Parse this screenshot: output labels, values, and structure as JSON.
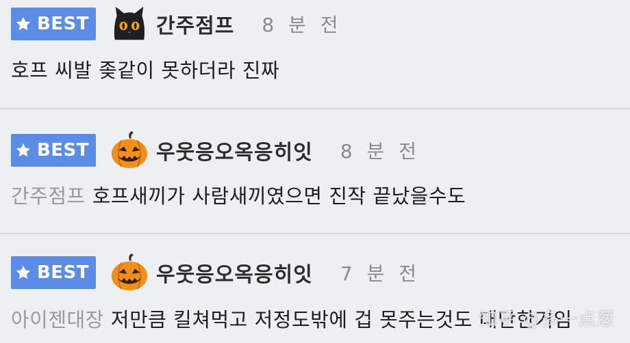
{
  "comments": [
    {
      "badge": "BEST",
      "username": "간주점프",
      "avatar_icon": "black-cat-icon",
      "time": "8 분 전",
      "reply_to": "",
      "text": "호프 씨발 좆같이 못하더라 진짜"
    },
    {
      "badge": "BEST",
      "username": "우웃응오옥응히잇",
      "avatar_icon": "jack-o-lantern-icon",
      "time": "8 분 전",
      "reply_to": "간주점프",
      "text": "호프새끼가 사람새끼였으면 진작 끝났을수도"
    },
    {
      "badge": "BEST",
      "username": "우웃응오옥응히잇",
      "avatar_icon": "jack-o-lantern-icon",
      "time": "7 분 전",
      "reply_to": "아이젠대장",
      "text": "저만큼 킬쳐먹고 저정도밖에 겁 못주는것도 대단한거임"
    }
  ],
  "watermark": "知乎 @多一点葱",
  "colors": {
    "badge_bg": "#5b8de6",
    "background": "#eeeff3",
    "divider": "#d6d7db",
    "time": "#8a8a8a",
    "reply_to": "#9a9a9a"
  }
}
